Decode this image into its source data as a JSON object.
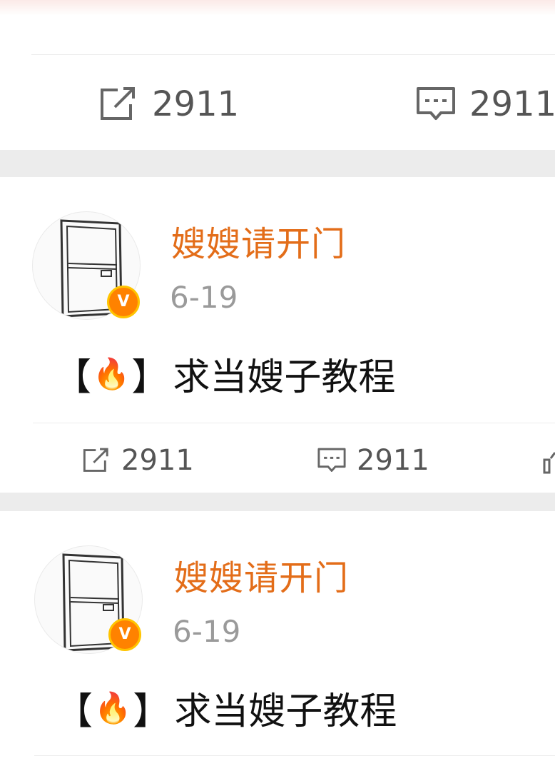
{
  "colors": {
    "username": "#e36d19",
    "badge": "#ff8200",
    "badge_ring": "#ffc400",
    "separator": "#ececec",
    "icon": "#666666"
  },
  "top_post": {
    "repost_count": "2911",
    "comment_count": "2911"
  },
  "posts": [
    {
      "username": "嫂嫂请开门",
      "time": "6-19",
      "avatar_icon": "door-icon",
      "verified_badge": "V",
      "content": {
        "bracket_open": "【",
        "emoji": "🔥",
        "bracket_close": "】",
        "text": "求当嫂子教程"
      },
      "repost_count": "2911",
      "comment_count": "2911"
    },
    {
      "username": "嫂嫂请开门",
      "time": "6-19",
      "avatar_icon": "door-icon",
      "verified_badge": "V",
      "content": {
        "bracket_open": "【",
        "emoji": "🔥",
        "bracket_close": "】",
        "text": "求当嫂子教程"
      }
    }
  ]
}
